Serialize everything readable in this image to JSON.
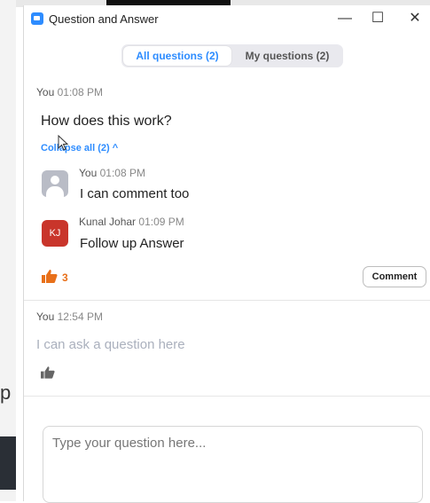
{
  "window": {
    "title": "Question and Answer",
    "minimize": "—",
    "maximize": "☐",
    "close": "✕"
  },
  "background": {
    "partial_text": "p"
  },
  "tabs": [
    {
      "label": "All questions (2)",
      "active": true
    },
    {
      "label": "My questions (2)",
      "active": false
    }
  ],
  "question1": {
    "author": "You",
    "time": "01:08 PM",
    "text": "How does this work?",
    "collapse_label": "Collapse all (2) ^",
    "replies": [
      {
        "author": "You",
        "time": "01:08 PM",
        "text": "I can comment too",
        "avatar": "person-icon"
      },
      {
        "author": "Kunal Johar",
        "time": "01:09 PM",
        "text": "Follow up Answer",
        "avatar_initials": "KJ"
      }
    ],
    "likes": "3",
    "comment_label": "Comment"
  },
  "question2": {
    "author": "You",
    "time": "12:54 PM",
    "text": "I can ask a question here"
  },
  "composer": {
    "placeholder": "Type your question here..."
  },
  "colors": {
    "accent": "#2d8cff",
    "like_orange": "#e8701a",
    "kj_avatar": "#c9352b"
  }
}
